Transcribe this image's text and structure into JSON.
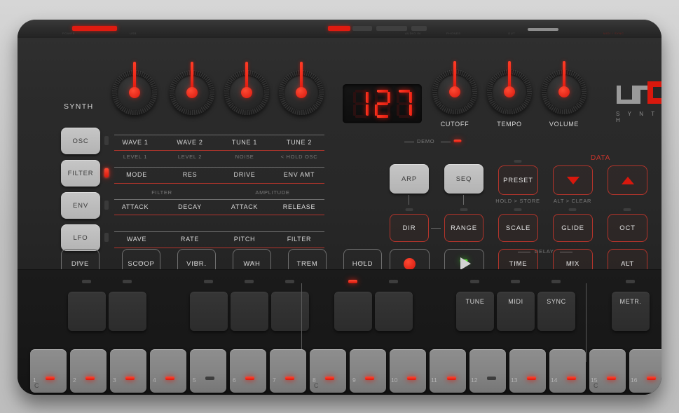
{
  "device": {
    "brand_logo": "UNO",
    "brand_sub": "S Y N T H",
    "section_label": "SYNTH"
  },
  "display": {
    "value": "127",
    "digits": [
      "1",
      "2",
      "7"
    ]
  },
  "rear_panel": {
    "labels": [
      "POWER",
      "USB",
      "AUDIO IN",
      "PHONES",
      "OUT",
      "MIDI IN",
      "MIDI OUT",
      "SYNC IN",
      "SYNC OUT"
    ]
  },
  "knobs": [
    {
      "name": "knob-1",
      "label": "",
      "angle": -2
    },
    {
      "name": "knob-2",
      "label": "",
      "angle": -2
    },
    {
      "name": "knob-3",
      "label": "",
      "angle": -2
    },
    {
      "name": "knob-4",
      "label": "",
      "angle": -2
    },
    {
      "name": "cutoff",
      "label": "CUTOFF",
      "angle": -2
    },
    {
      "name": "tempo",
      "label": "TEMPO",
      "angle": -2
    },
    {
      "name": "volume",
      "label": "VOLUME",
      "angle": -2
    }
  ],
  "knob_labels": {
    "cutoff": "CUTOFF",
    "tempo": "TEMPO",
    "volume": "VOLUME"
  },
  "mode_buttons": [
    {
      "label": "OSC",
      "led_on": false
    },
    {
      "label": "FILTER",
      "led_on": true
    },
    {
      "label": "ENV",
      "led_on": false
    },
    {
      "label": "LFO",
      "led_on": false
    }
  ],
  "matrix": {
    "osc": {
      "primary": [
        "WAVE 1",
        "WAVE 2",
        "TUNE 1",
        "TUNE 2"
      ],
      "secondary": [
        "LEVEL 1",
        "LEVEL 2",
        "NOISE",
        "< HOLD OSC"
      ]
    },
    "filter": {
      "primary": [
        "MODE",
        "RES",
        "DRIVE",
        "ENV AMT"
      ],
      "secondary": []
    },
    "env": {
      "group_left": "FILTER",
      "group_right": "AMPLITUDE",
      "primary": [
        "ATTACK",
        "DECAY",
        "ATTACK",
        "RELEASE"
      ],
      "secondary": []
    },
    "lfo": {
      "primary": [
        "WAVE",
        "RATE",
        "PITCH",
        "FILTER"
      ],
      "secondary": []
    }
  },
  "sequencer": {
    "demo_label": "DEMO",
    "demo_led_on": true,
    "arp": "ARP",
    "seq": "SEQ",
    "dir": "DIR",
    "range": "RANGE"
  },
  "preset_section": {
    "data_label": "DATA",
    "preset": "PRESET",
    "preset_sub": "HOLD > STORE",
    "down_arrow": "▼",
    "up_arrow": "▲",
    "down_sub": "ALT > CLEAR",
    "scale": "SCALE",
    "glide": "GLIDE",
    "oct": "OCT"
  },
  "delay_section": {
    "title": "DELAY",
    "time": "TIME",
    "mix": "MIX",
    "alt": "ALT"
  },
  "performance_buttons": [
    {
      "label": "DIVE",
      "led_on": false
    },
    {
      "label": "SCOOP",
      "led_on": false
    },
    {
      "label": "VIBR.",
      "led_on": false
    },
    {
      "label": "WAH",
      "led_on": false
    },
    {
      "label": "TREM",
      "led_on": false
    },
    {
      "label": "HOLD",
      "led_on": false
    }
  ],
  "transport": {
    "record": "record-icon",
    "play": "play-icon",
    "record_led_on": false,
    "play_led_on": true,
    "play_led_color": "#3cdc28"
  },
  "function_pads": [
    {
      "label": "TUNE"
    },
    {
      "label": "MIDI"
    },
    {
      "label": "SYNC"
    },
    {
      "label": "METR."
    }
  ],
  "black_keys": [
    {
      "index": 0,
      "label": "",
      "led_on": false
    },
    {
      "index": 1,
      "label": "",
      "led_on": false
    },
    {
      "index": 2,
      "label": "",
      "led_on": false
    },
    {
      "index": 3,
      "label": "",
      "led_on": false
    },
    {
      "index": 4,
      "label": "",
      "led_on": false
    },
    {
      "index": 5,
      "label": "",
      "led_on": true
    },
    {
      "index": 6,
      "label": "",
      "led_on": false
    },
    {
      "index": 7,
      "label": "TUNE",
      "led_on": false
    },
    {
      "index": 8,
      "label": "MIDI",
      "led_on": false
    },
    {
      "index": 9,
      "label": "SYNC",
      "led_on": false
    },
    {
      "index": 10,
      "label": "METR.",
      "led_on": false
    }
  ],
  "steps": [
    {
      "num": "1",
      "led_on": true,
      "note": "C"
    },
    {
      "num": "2",
      "led_on": true,
      "note": ""
    },
    {
      "num": "3",
      "led_on": true,
      "note": ""
    },
    {
      "num": "4",
      "led_on": true,
      "note": ""
    },
    {
      "num": "5",
      "led_on": false,
      "note": ""
    },
    {
      "num": "6",
      "led_on": true,
      "note": ""
    },
    {
      "num": "7",
      "led_on": true,
      "note": ""
    },
    {
      "num": "8",
      "led_on": true,
      "note": "C"
    },
    {
      "num": "9",
      "led_on": true,
      "note": ""
    },
    {
      "num": "10",
      "led_on": true,
      "note": ""
    },
    {
      "num": "11",
      "led_on": true,
      "note": ""
    },
    {
      "num": "12",
      "led_on": false,
      "note": ""
    },
    {
      "num": "13",
      "led_on": true,
      "note": ""
    },
    {
      "num": "14",
      "led_on": true,
      "note": ""
    },
    {
      "num": "15",
      "led_on": true,
      "note": "C"
    },
    {
      "num": "16",
      "led_on": true,
      "note": ""
    }
  ],
  "colors": {
    "accent_red": "#d8180d",
    "led_green": "#3cdc28",
    "panel": "#2a2a2a",
    "keybed": "#181818",
    "white_key": "#848484"
  }
}
